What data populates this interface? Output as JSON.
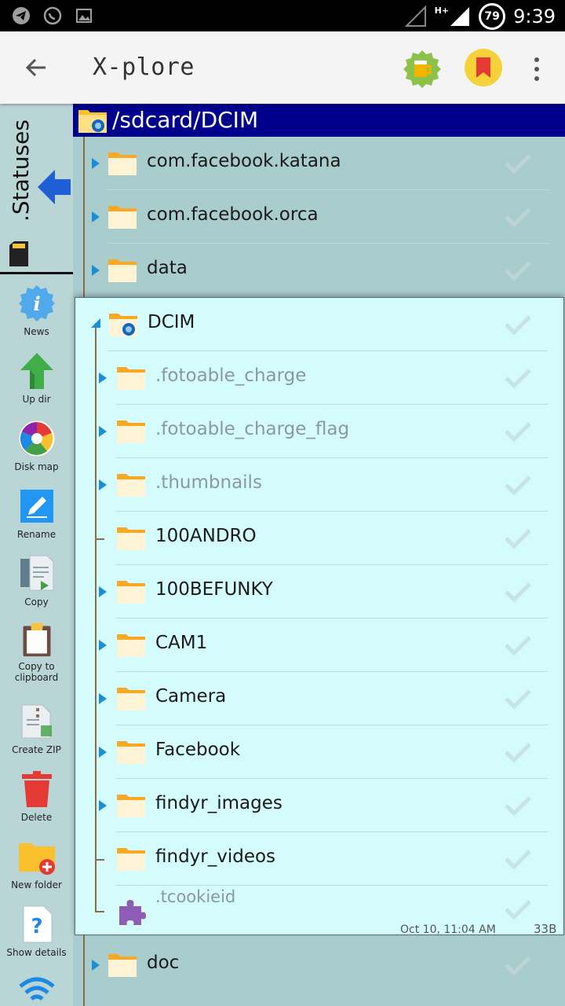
{
  "statusbar": {
    "network": "H+",
    "battery": "79",
    "time": "9:39"
  },
  "appbar": {
    "title": "X-plore"
  },
  "side_tab": {
    "label": ".Statuses"
  },
  "toolbar": {
    "items": [
      {
        "label": "News",
        "icon": "info-icon"
      },
      {
        "label": "Up dir",
        "icon": "up-arrow-icon"
      },
      {
        "label": "Disk map",
        "icon": "disk-map-icon"
      },
      {
        "label": "Rename",
        "icon": "pencil-icon"
      },
      {
        "label": "Copy",
        "icon": "copy-icon"
      },
      {
        "label": "Copy to clipboard",
        "icon": "clipboard-icon"
      },
      {
        "label": "Create ZIP",
        "icon": "zip-icon"
      },
      {
        "label": "Delete",
        "icon": "trash-icon"
      },
      {
        "label": "New folder",
        "icon": "new-folder-icon"
      },
      {
        "label": "Show details",
        "icon": "help-icon"
      },
      {
        "label": "",
        "icon": "wifi-icon"
      }
    ]
  },
  "path": "/sdcard/DCIM",
  "top_folders": [
    {
      "name": "com.facebook.katana"
    },
    {
      "name": "com.facebook.orca"
    },
    {
      "name": "data"
    }
  ],
  "dcim": {
    "name": "DCIM",
    "children": [
      {
        "name": ".fotoable_charge",
        "hidden": true,
        "expandable": true
      },
      {
        "name": ".fotoable_charge_flag",
        "hidden": true,
        "expandable": true
      },
      {
        "name": ".thumbnails",
        "hidden": true,
        "expandable": true
      },
      {
        "name": "100ANDRO",
        "hidden": false,
        "expandable": false
      },
      {
        "name": "100BEFUNKY",
        "hidden": false,
        "expandable": true
      },
      {
        "name": "CAM1",
        "hidden": false,
        "expandable": true
      },
      {
        "name": "Camera",
        "hidden": false,
        "expandable": true
      },
      {
        "name": "Facebook",
        "hidden": false,
        "expandable": true
      },
      {
        "name": "findyr_images",
        "hidden": false,
        "expandable": true
      },
      {
        "name": "findyr_videos",
        "hidden": false,
        "expandable": false
      }
    ],
    "file": {
      "name": ".tcookieid",
      "date": "Oct 10, 11:04 AM",
      "size": "33B"
    }
  },
  "bottom_folders": [
    {
      "name": "doc"
    }
  ],
  "colors": {
    "path_bar": "#00008c",
    "expand_arrow": "#1a8fd6",
    "panel_bg": "#a9cccd",
    "dcim_bg": "#d4fcfd"
  }
}
